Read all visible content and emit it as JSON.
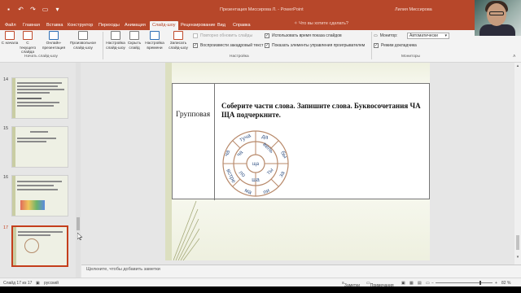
{
  "colors": {
    "accent": "#b7472a",
    "selected_slide_border": "#c43e1c"
  },
  "titlebar": {
    "document_title": "Презентация Миссирова Л. - PowerPoint",
    "user": "Лилия Миссирова",
    "qat_icons": [
      "save-icon",
      "undo-icon",
      "redo-icon",
      "present-icon",
      "customize-icon"
    ]
  },
  "tabs": [
    {
      "label": "Файл"
    },
    {
      "label": "Главная"
    },
    {
      "label": "Вставка"
    },
    {
      "label": "Конструктор"
    },
    {
      "label": "Переходы"
    },
    {
      "label": "Анимация"
    },
    {
      "label": "Слайд-шоу"
    },
    {
      "label": "Рецензирование"
    },
    {
      "label": "Вид"
    },
    {
      "label": "Справка"
    }
  ],
  "active_tab": "Слайд-шоу",
  "tell_me": "Что вы хотите сделать?",
  "ribbon": {
    "buttons": {
      "from_start": "С начала",
      "from_current": "С текущего слайда",
      "online": "Онлайн-презентация",
      "custom": "Произвольное слайд-шоу",
      "setup": "Настройка слайд-шоу",
      "hide": "Скрыть слайд",
      "rehearse": "Настройка времени",
      "record": "Записать слайд-шоу"
    },
    "checks": {
      "rerecord": "Повторно обновить слайды",
      "narration": "Воспроизвести закадровый текст",
      "use_timings": "Использовать время показа слайдов",
      "show_controls": "Показать элементы управления проигрывателем",
      "presenter_view": "Режим докладчика"
    },
    "monitor_label": "Монитор:",
    "monitor_value": "Автоматически",
    "groups": {
      "start": "Начать слайд-шоу",
      "setup": "Настройка",
      "monitors": "Мониторы"
    }
  },
  "thumbnails": [
    {
      "number": "14"
    },
    {
      "number": "15"
    },
    {
      "number": "16"
    },
    {
      "number": "17",
      "selected": true
    }
  ],
  "slide": {
    "row_label": "Групповая",
    "task_text": "Соберите части слова. Запишите слова. Буквосочетания ЧА ЩА подчеркните.",
    "wheel_syllables": [
      "туча",
      "да",
      "вель",
      "ты",
      "ша",
      "до",
      "бы",
      "за",
      "пи",
      "ма",
      "встре",
      "ча",
      "ло",
      "ча",
      "ща",
      "ча",
      "та"
    ]
  },
  "notes_placeholder": "Щелкните, чтобы добавить заметки",
  "statusbar": {
    "slide_info": "Слайд 17 из 17",
    "language": "русский",
    "notes": "Заметки",
    "comments": "Примечания",
    "zoom": "82 %"
  }
}
